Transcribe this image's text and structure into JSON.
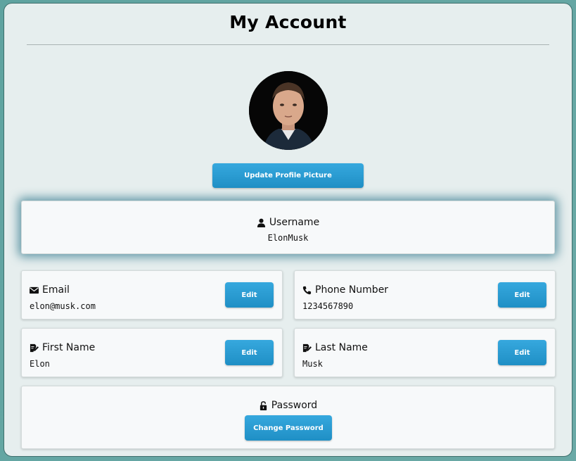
{
  "page": {
    "title": "My Account"
  },
  "profile": {
    "update_picture_label": "Update Profile Picture"
  },
  "username": {
    "label": "Username",
    "value": "ElonMusk"
  },
  "email": {
    "label": "Email",
    "value": "elon@musk.com",
    "edit_label": "Edit"
  },
  "phone": {
    "label": "Phone Number",
    "value": "1234567890",
    "edit_label": "Edit"
  },
  "first_name": {
    "label": "First Name",
    "value": "Elon",
    "edit_label": "Edit"
  },
  "last_name": {
    "label": "Last Name",
    "value": "Musk",
    "edit_label": "Edit"
  },
  "password": {
    "label": "Password",
    "change_label": "Change Password"
  },
  "colors": {
    "accent": "#2a9fd6",
    "background": "#e6eeee",
    "card": "#f7f9fa"
  }
}
